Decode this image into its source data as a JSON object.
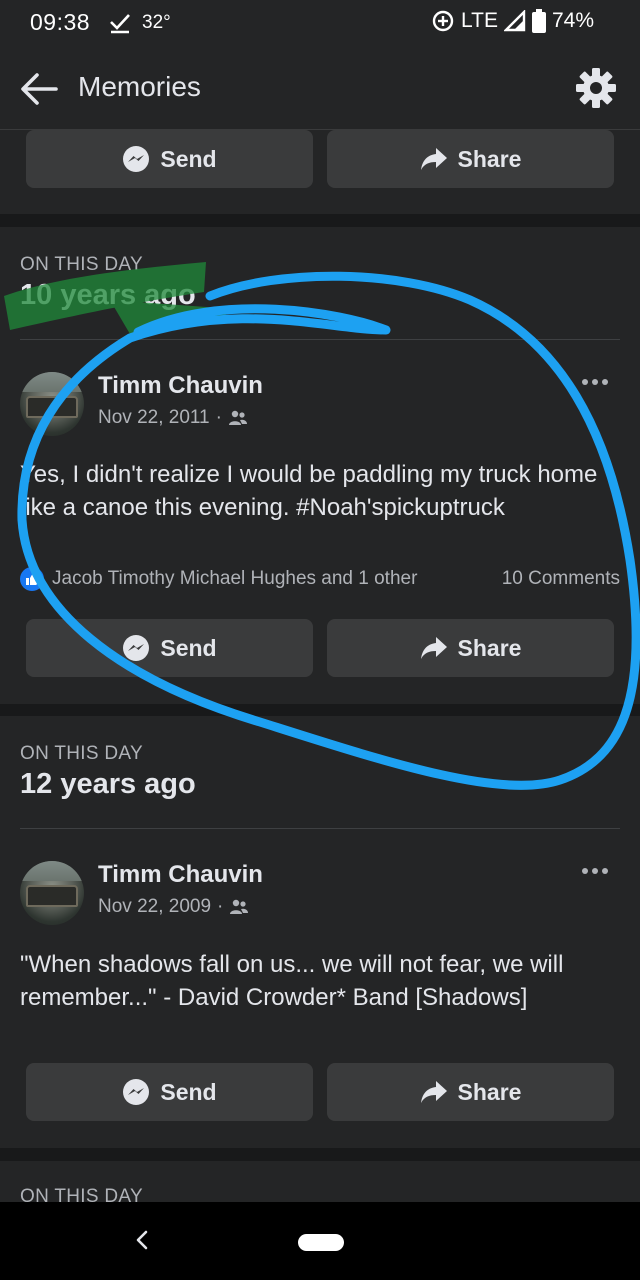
{
  "status_bar": {
    "time": "09:38",
    "temperature": "32°",
    "network": "LTE",
    "battery": "74%"
  },
  "app_bar": {
    "title": "Memories",
    "back_icon": "arrow-left-icon",
    "settings_icon": "gear-icon"
  },
  "top_card": {
    "send_label": "Send",
    "share_label": "Share"
  },
  "memories": [
    {
      "label": "ON THIS DAY",
      "years_ago": "10 years ago",
      "author": "Timm Chauvin",
      "date": "Nov 22, 2011",
      "audience_icon": "friends-icon",
      "text": "Yes, I didn't realize I would be paddling my truck home like a canoe this evening. #Noah'spickuptruck",
      "reactions": "Jacob Timothy Michael Hughes and 1 other",
      "comments": "10 Comments",
      "send_label": "Send",
      "share_label": "Share"
    },
    {
      "label": "ON THIS DAY",
      "years_ago": "12 years ago",
      "author": "Timm Chauvin",
      "date": "Nov 22, 2009",
      "audience_icon": "friends-icon",
      "text": "\"When shadows fall on us... we will not fear, we will remember...\" - David Crowder* Band [Shadows]",
      "send_label": "Send",
      "share_label": "Share"
    },
    {
      "label": "ON THIS DAY"
    }
  ],
  "colors": {
    "background": "#18191a",
    "card": "#242526",
    "button": "#3a3b3c",
    "like_blue": "#1877f2",
    "annotation_blue": "#1da1f2",
    "annotation_green": "#1f8a3a"
  }
}
